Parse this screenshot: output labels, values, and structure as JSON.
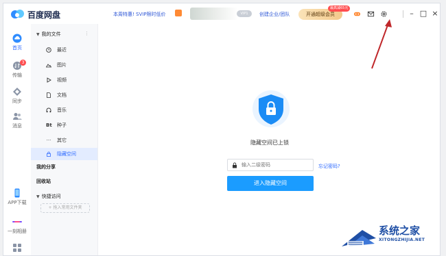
{
  "app": {
    "title": "百度网盘",
    "promo": "本周特惠! SVIP限时低价",
    "vip_badge": "VIP1",
    "enterprise_link": "创建企业/团队",
    "svip_button": "开通超级会员",
    "svip_tag": "最高减65元"
  },
  "rail": {
    "items": [
      {
        "label": "首页",
        "icon": "cloud-icon"
      },
      {
        "label": "传输",
        "icon": "transfer-icon",
        "badge": "3"
      },
      {
        "label": "同步",
        "icon": "sync-icon"
      },
      {
        "label": "消息",
        "icon": "message-icon"
      },
      {
        "label": "APP下载",
        "icon": "phone-icon"
      },
      {
        "label": "一刻相册",
        "icon": "album-icon"
      }
    ]
  },
  "sidebar": {
    "my_files": "我的文件",
    "items": [
      {
        "label": "最近",
        "icon": "clock-icon"
      },
      {
        "label": "图片",
        "icon": "image-icon"
      },
      {
        "label": "视频",
        "icon": "video-icon"
      },
      {
        "label": "文档",
        "icon": "document-icon"
      },
      {
        "label": "音乐",
        "icon": "music-icon"
      },
      {
        "label": "种子",
        "icon": "bt-icon",
        "glyph": "Bt"
      },
      {
        "label": "其它",
        "icon": "more-icon",
        "glyph": "···"
      },
      {
        "label": "隐藏空间",
        "icon": "lock-icon"
      }
    ],
    "my_share": "我的分享",
    "recycle": "回收站",
    "quick_access": "快捷访问",
    "add_folder": "+ 拖入常用文件夹"
  },
  "main": {
    "title": "隐藏空间已上锁",
    "password_placeholder": "输入二级密码",
    "forgot": "忘记密码?",
    "enter_button": "进入隐藏空间"
  },
  "watermark": {
    "cn": "系统之家",
    "en": "XITONGZHIJIA.NET"
  },
  "colors": {
    "accent": "#2f6bff",
    "button": "#1b9cff",
    "shield": "#1b8cf5",
    "annotation": "#c0282b"
  }
}
